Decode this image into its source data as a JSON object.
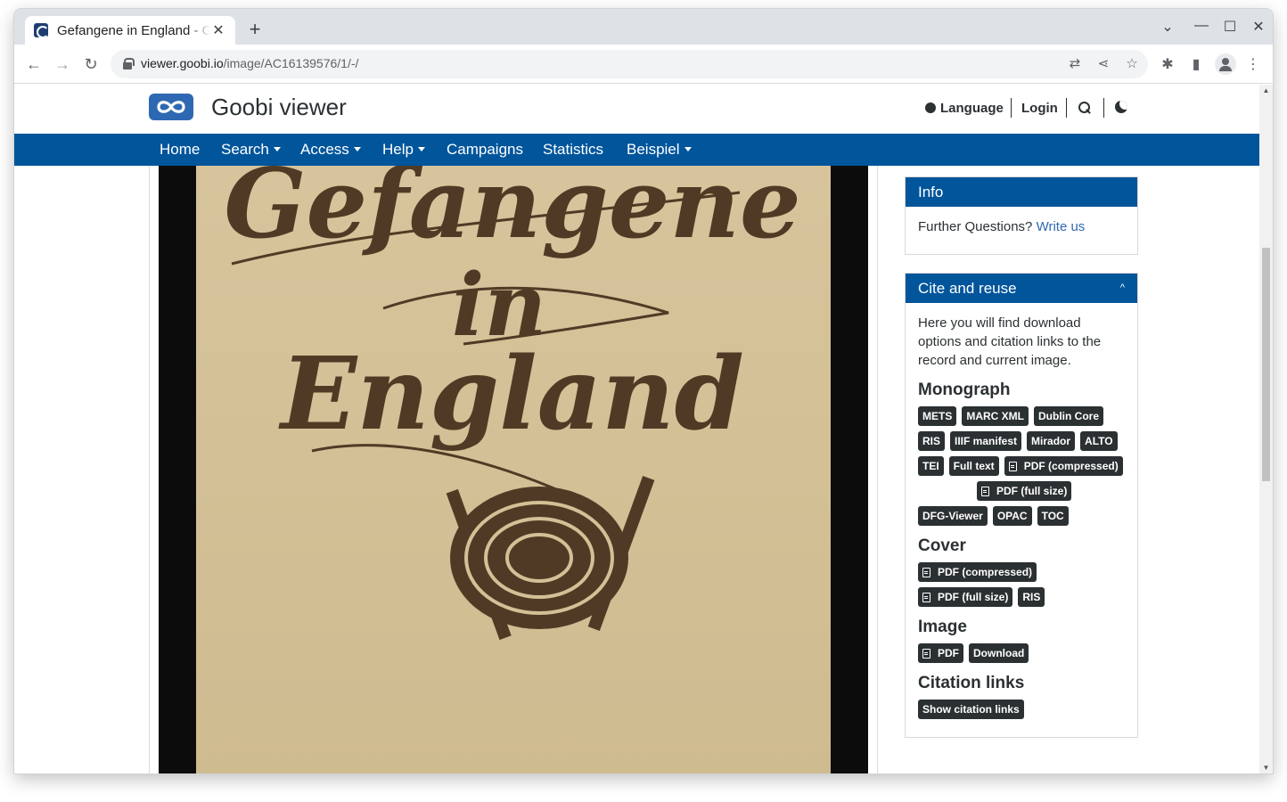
{
  "browser": {
    "tab_title": "Gefangene in England - Goobi viewer",
    "tab_close": "✕",
    "new_tab": "+",
    "url_host": "viewer.goobi.io",
    "url_path": "/image/AC16139576/1/-/",
    "controls": {
      "tab_list": "⌄",
      "minimize": "—",
      "maximize": "☐",
      "close": "✕"
    }
  },
  "header": {
    "brand": "Goobi viewer",
    "language": "Language",
    "login": "Login"
  },
  "nav": {
    "home": "Home",
    "search": "Search",
    "access": "Access",
    "help": "Help",
    "campaigns": "Campaigns",
    "statistics": "Statistics",
    "beispiel": "Beispiel"
  },
  "scan": {
    "title_line1": "Gefangene",
    "title_line2": "in",
    "title_line3": "England"
  },
  "info_widget": {
    "title": "Info",
    "text": "Further Questions?",
    "link": "Write us"
  },
  "cite_widget": {
    "title": "Cite and reuse",
    "chevron": "^",
    "intro": "Here you will find download options and citation links to the record and current image.",
    "monograph": {
      "heading": "Monograph",
      "badges": [
        "METS",
        "MARC XML",
        "Dublin Core",
        "RIS",
        "IIIF manifest",
        "Mirador",
        "ALTO",
        "TEI",
        "Full text",
        "PDF (compressed)",
        "PDF (full size)",
        "DFG-Viewer",
        "OPAC",
        "TOC"
      ]
    },
    "cover": {
      "heading": "Cover",
      "badges": [
        "PDF (compressed)",
        "PDF (full size)",
        "RIS"
      ]
    },
    "image": {
      "heading": "Image",
      "badges": [
        "PDF",
        "Download"
      ]
    },
    "citation": {
      "heading": "Citation links",
      "button": "Show citation links"
    }
  },
  "colors": {
    "brand_blue": "#00559b",
    "badge_dark": "#2b3033",
    "link_blue": "#2f68b2",
    "paper": "#d3c096",
    "ink": "#4f3b25"
  }
}
